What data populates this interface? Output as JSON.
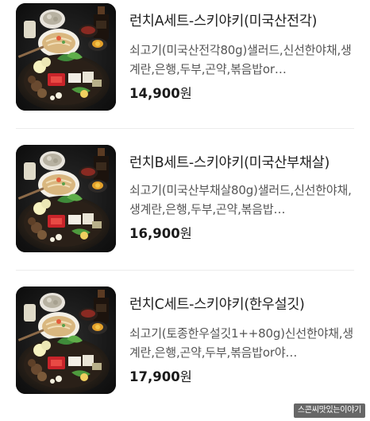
{
  "menu": {
    "items": [
      {
        "name": "런치A세트-스키야키(미국산전각)",
        "description": "쇠고기(미국산전각80g)샐러드,신선한야채,생계란,은행,두부,곤약,볶음밥or…",
        "price": "14,900",
        "currency": "원",
        "image_icon": "sukiyaki-set-photo"
      },
      {
        "name": "런치B세트-스키야키(미국산부채살)",
        "description": "쇠고기(미국산부채살80g)샐러드,신선한야채,생계란,은행,두부,곤약,볶음밥…",
        "price": "16,900",
        "currency": "원",
        "image_icon": "sukiyaki-set-photo"
      },
      {
        "name": "런치C세트-스키야키(한우설깃)",
        "description": "쇠고기(토종한우설깃1++80g)신선한야채,생계란,은행,곤약,두부,볶음밥or야…",
        "price": "17,900",
        "currency": "원",
        "image_icon": "sukiyaki-set-photo"
      }
    ]
  },
  "watermark": {
    "text": "스콘씨맛있는이야기"
  }
}
